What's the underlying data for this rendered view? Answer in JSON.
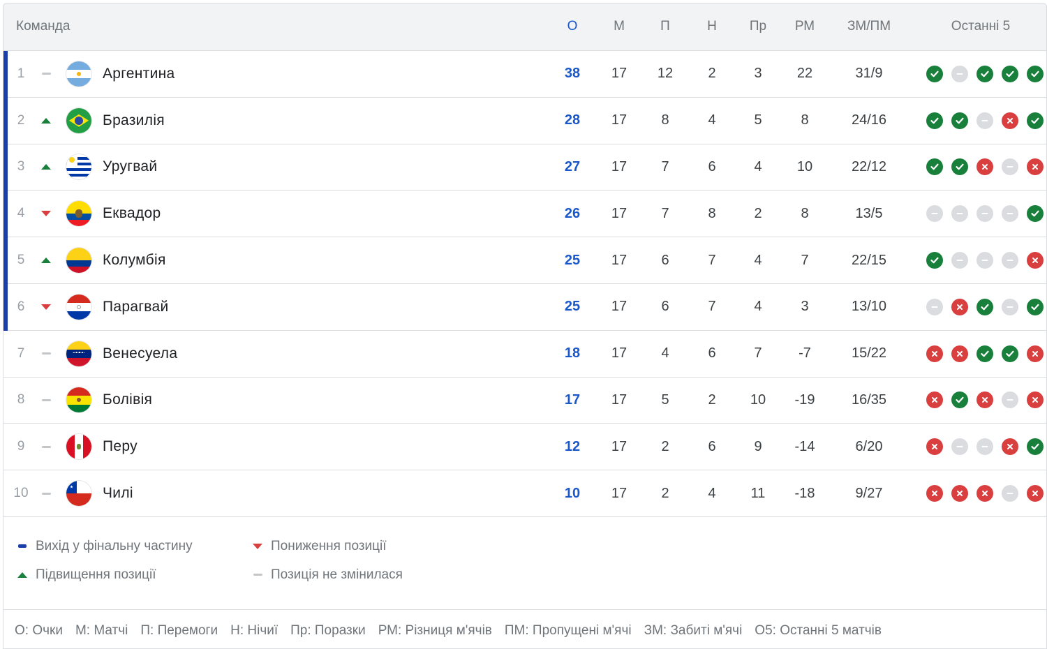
{
  "header": {
    "team": "Команда",
    "points": "О",
    "played": "М",
    "wins": "П",
    "draws": "Н",
    "losses": "Пр",
    "goal_diff": "РМ",
    "goals": "ЗМ/ПМ",
    "last5": "Останні 5"
  },
  "colors": {
    "qualified_bar": "#1a3fa8",
    "win": "#18803b",
    "loss": "#d93f3f",
    "draw": "#dadce0",
    "points_text": "#1a57c9"
  },
  "rows": [
    {
      "pos": "1",
      "trend": "same",
      "flag": "argentina-flag",
      "name": "Аргентина",
      "pts": "38",
      "m": "17",
      "w": "12",
      "d": "2",
      "l": "3",
      "gd": "22",
      "goals": "31/9",
      "last5": [
        "w",
        "d",
        "w",
        "w",
        "w"
      ],
      "qualified": true
    },
    {
      "pos": "2",
      "trend": "up",
      "flag": "brazil-flag",
      "name": "Бразилія",
      "pts": "28",
      "m": "17",
      "w": "8",
      "d": "4",
      "l": "5",
      "gd": "8",
      "goals": "24/16",
      "last5": [
        "w",
        "w",
        "d",
        "l",
        "w"
      ],
      "qualified": true
    },
    {
      "pos": "3",
      "trend": "up",
      "flag": "uruguay-flag",
      "name": "Уругвай",
      "pts": "27",
      "m": "17",
      "w": "7",
      "d": "6",
      "l": "4",
      "gd": "10",
      "goals": "22/12",
      "last5": [
        "w",
        "w",
        "l",
        "d",
        "l"
      ],
      "qualified": true
    },
    {
      "pos": "4",
      "trend": "down",
      "flag": "ecuador-flag",
      "name": "Еквадор",
      "pts": "26",
      "m": "17",
      "w": "7",
      "d": "8",
      "l": "2",
      "gd": "8",
      "goals": "13/5",
      "last5": [
        "d",
        "d",
        "d",
        "d",
        "w"
      ],
      "qualified": true
    },
    {
      "pos": "5",
      "trend": "up",
      "flag": "colombia-flag",
      "name": "Колумбія",
      "pts": "25",
      "m": "17",
      "w": "6",
      "d": "7",
      "l": "4",
      "gd": "7",
      "goals": "22/15",
      "last5": [
        "w",
        "d",
        "d",
        "d",
        "l"
      ],
      "qualified": true
    },
    {
      "pos": "6",
      "trend": "down",
      "flag": "paraguay-flag",
      "name": "Парагвай",
      "pts": "25",
      "m": "17",
      "w": "6",
      "d": "7",
      "l": "4",
      "gd": "3",
      "goals": "13/10",
      "last5": [
        "d",
        "l",
        "w",
        "d",
        "w"
      ],
      "qualified": true
    },
    {
      "pos": "7",
      "trend": "same",
      "flag": "venezuela-flag",
      "name": "Венесуела",
      "pts": "18",
      "m": "17",
      "w": "4",
      "d": "6",
      "l": "7",
      "gd": "-7",
      "goals": "15/22",
      "last5": [
        "l",
        "l",
        "w",
        "w",
        "l"
      ],
      "qualified": false
    },
    {
      "pos": "8",
      "trend": "same",
      "flag": "bolivia-flag",
      "name": "Болівія",
      "pts": "17",
      "m": "17",
      "w": "5",
      "d": "2",
      "l": "10",
      "gd": "-19",
      "goals": "16/35",
      "last5": [
        "l",
        "w",
        "l",
        "d",
        "l"
      ],
      "qualified": false
    },
    {
      "pos": "9",
      "trend": "same",
      "flag": "peru-flag",
      "name": "Перу",
      "pts": "12",
      "m": "17",
      "w": "2",
      "d": "6",
      "l": "9",
      "gd": "-14",
      "goals": "6/20",
      "last5": [
        "l",
        "d",
        "d",
        "l",
        "w"
      ],
      "qualified": false
    },
    {
      "pos": "10",
      "trend": "same",
      "flag": "chile-flag",
      "name": "Чилі",
      "pts": "10",
      "m": "17",
      "w": "2",
      "d": "4",
      "l": "11",
      "gd": "-18",
      "goals": "9/27",
      "last5": [
        "l",
        "l",
        "l",
        "d",
        "l"
      ],
      "qualified": false
    }
  ],
  "legend": {
    "qualified": "Вихід у фінальну частину",
    "up": "Підвищення позиції",
    "down": "Пониження позиції",
    "same": "Позиція не змінилася"
  },
  "abbreviations": [
    "О: Очки",
    "М: Матчі",
    "П: Перемоги",
    "Н: Нічиї",
    "Пр: Поразки",
    "РМ: Різниця м'ячів",
    "ПМ: Пропущені м'ячі",
    "ЗМ: Забиті м'ячі",
    "О5: Останні 5 матчів"
  ]
}
